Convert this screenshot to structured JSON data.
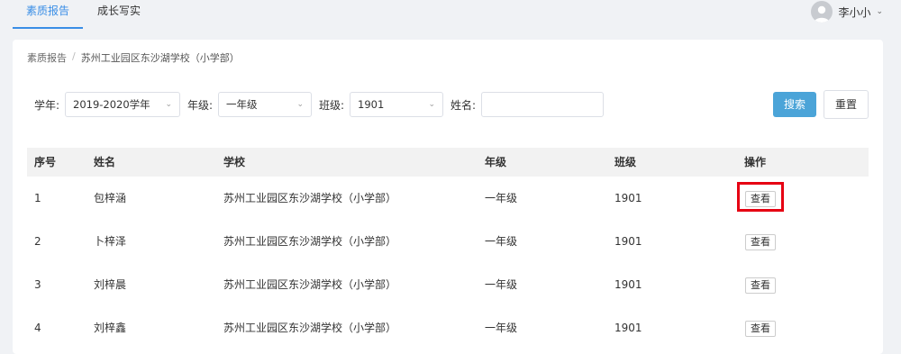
{
  "nav": {
    "tabs": [
      {
        "label": "素质报告",
        "active": true
      },
      {
        "label": "成长写实",
        "active": false
      }
    ],
    "user_name": "李小小"
  },
  "breadcrumb": {
    "root": "素质报告",
    "separator": "/",
    "current": "苏州工业园区东沙湖学校（小学部）"
  },
  "filters": {
    "year_label": "学年:",
    "year_value": "2019-2020学年",
    "grade_label": "年级:",
    "grade_value": "一年级",
    "class_label": "班级:",
    "class_value": "1901",
    "name_label": "姓名:",
    "name_value": "",
    "search_label": "搜索",
    "reset_label": "重置"
  },
  "table": {
    "headers": {
      "idx": "序号",
      "name": "姓名",
      "school": "学校",
      "grade": "年级",
      "class": "班级",
      "op": "操作"
    },
    "rows": [
      {
        "idx": "1",
        "name": "包梓涵",
        "school": "苏州工业园区东沙湖学校（小学部）",
        "grade": "一年级",
        "class": "1901",
        "op": "查看"
      },
      {
        "idx": "2",
        "name": "卜梓泽",
        "school": "苏州工业园区东沙湖学校（小学部）",
        "grade": "一年级",
        "class": "1901",
        "op": "查看"
      },
      {
        "idx": "3",
        "name": "刘梓晨",
        "school": "苏州工业园区东沙湖学校（小学部）",
        "grade": "一年级",
        "class": "1901",
        "op": "查看"
      },
      {
        "idx": "4",
        "name": "刘梓鑫",
        "school": "苏州工业园区东沙湖学校（小学部）",
        "grade": "一年级",
        "class": "1901",
        "op": "查看"
      }
    ]
  },
  "colors": {
    "accent": "#3a8ee6",
    "search_button": "#4ba4d8",
    "highlight_border": "#e60012"
  }
}
